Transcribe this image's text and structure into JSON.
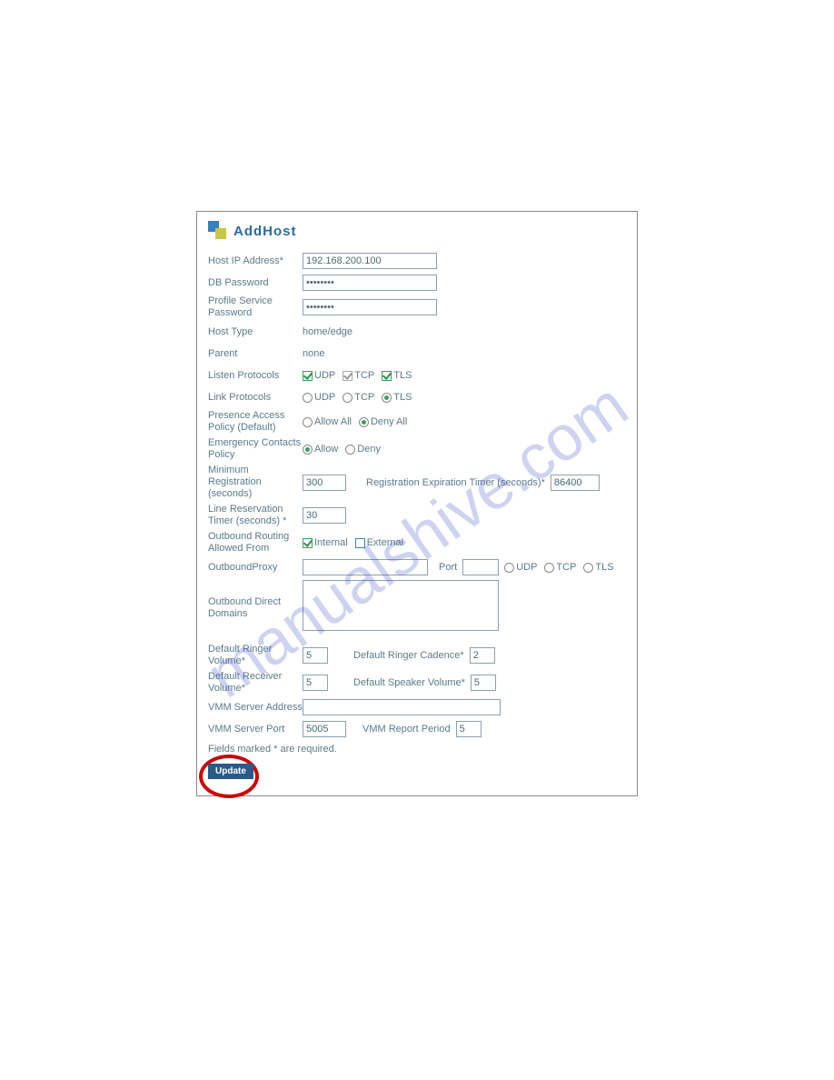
{
  "watermark": "manualshive.com",
  "title": "AddHost",
  "fields": {
    "host_ip_label": "Host IP Address*",
    "host_ip_value": "192.168.200.100",
    "db_password_label": "DB Password",
    "db_password_value": "••••••••",
    "profile_password_label": "Profile Service Password",
    "profile_password_value": "••••••••",
    "host_type_label": "Host Type",
    "host_type_value": "home/edge",
    "parent_label": "Parent",
    "parent_value": "none",
    "listen_protocols_label": "Listen Protocols",
    "link_protocols_label": "Link Protocols",
    "presence_policy_label": "Presence Access Policy (Default)",
    "emergency_label": "Emergency Contacts Policy",
    "min_reg_label": "Minimum Registration (seconds)",
    "min_reg_value": "300",
    "reg_exp_label": "Registration Expiration Timer (seconds)*",
    "reg_exp_value": "86400",
    "line_res_label": "Line Reservation Timer (seconds) *",
    "line_res_value": "30",
    "out_routing_label": "Outbound Routing Allowed From",
    "outbound_proxy_label": "OutboundProxy",
    "outbound_proxy_value": "",
    "port_label": "Port",
    "port_value": "",
    "out_direct_label": "Outbound Direct Domains",
    "def_ringer_vol_label": "Default Ringer Volume*",
    "def_ringer_vol_value": "5",
    "def_ringer_cad_label": "Default Ringer Cadence*",
    "def_ringer_cad_value": "2",
    "def_receiver_vol_label": "Default Receiver Volume*",
    "def_receiver_vol_value": "5",
    "def_speaker_vol_label": "Default Speaker Volume*",
    "def_speaker_vol_value": "5",
    "vmm_addr_label": "VMM Server Address",
    "vmm_addr_value": "",
    "vmm_port_label": "VMM Server Port",
    "vmm_port_value": "5005",
    "vmm_report_label": "VMM Report Period",
    "vmm_report_value": "5",
    "note": "Fields marked * are required.",
    "update_label": "Update"
  },
  "options": {
    "udp": "UDP",
    "tcp": "TCP",
    "tls": "TLS",
    "allow_all": "Allow All",
    "deny_all": "Deny All",
    "allow": "Allow",
    "deny": "Deny",
    "internal": "Internal",
    "external": "External"
  }
}
